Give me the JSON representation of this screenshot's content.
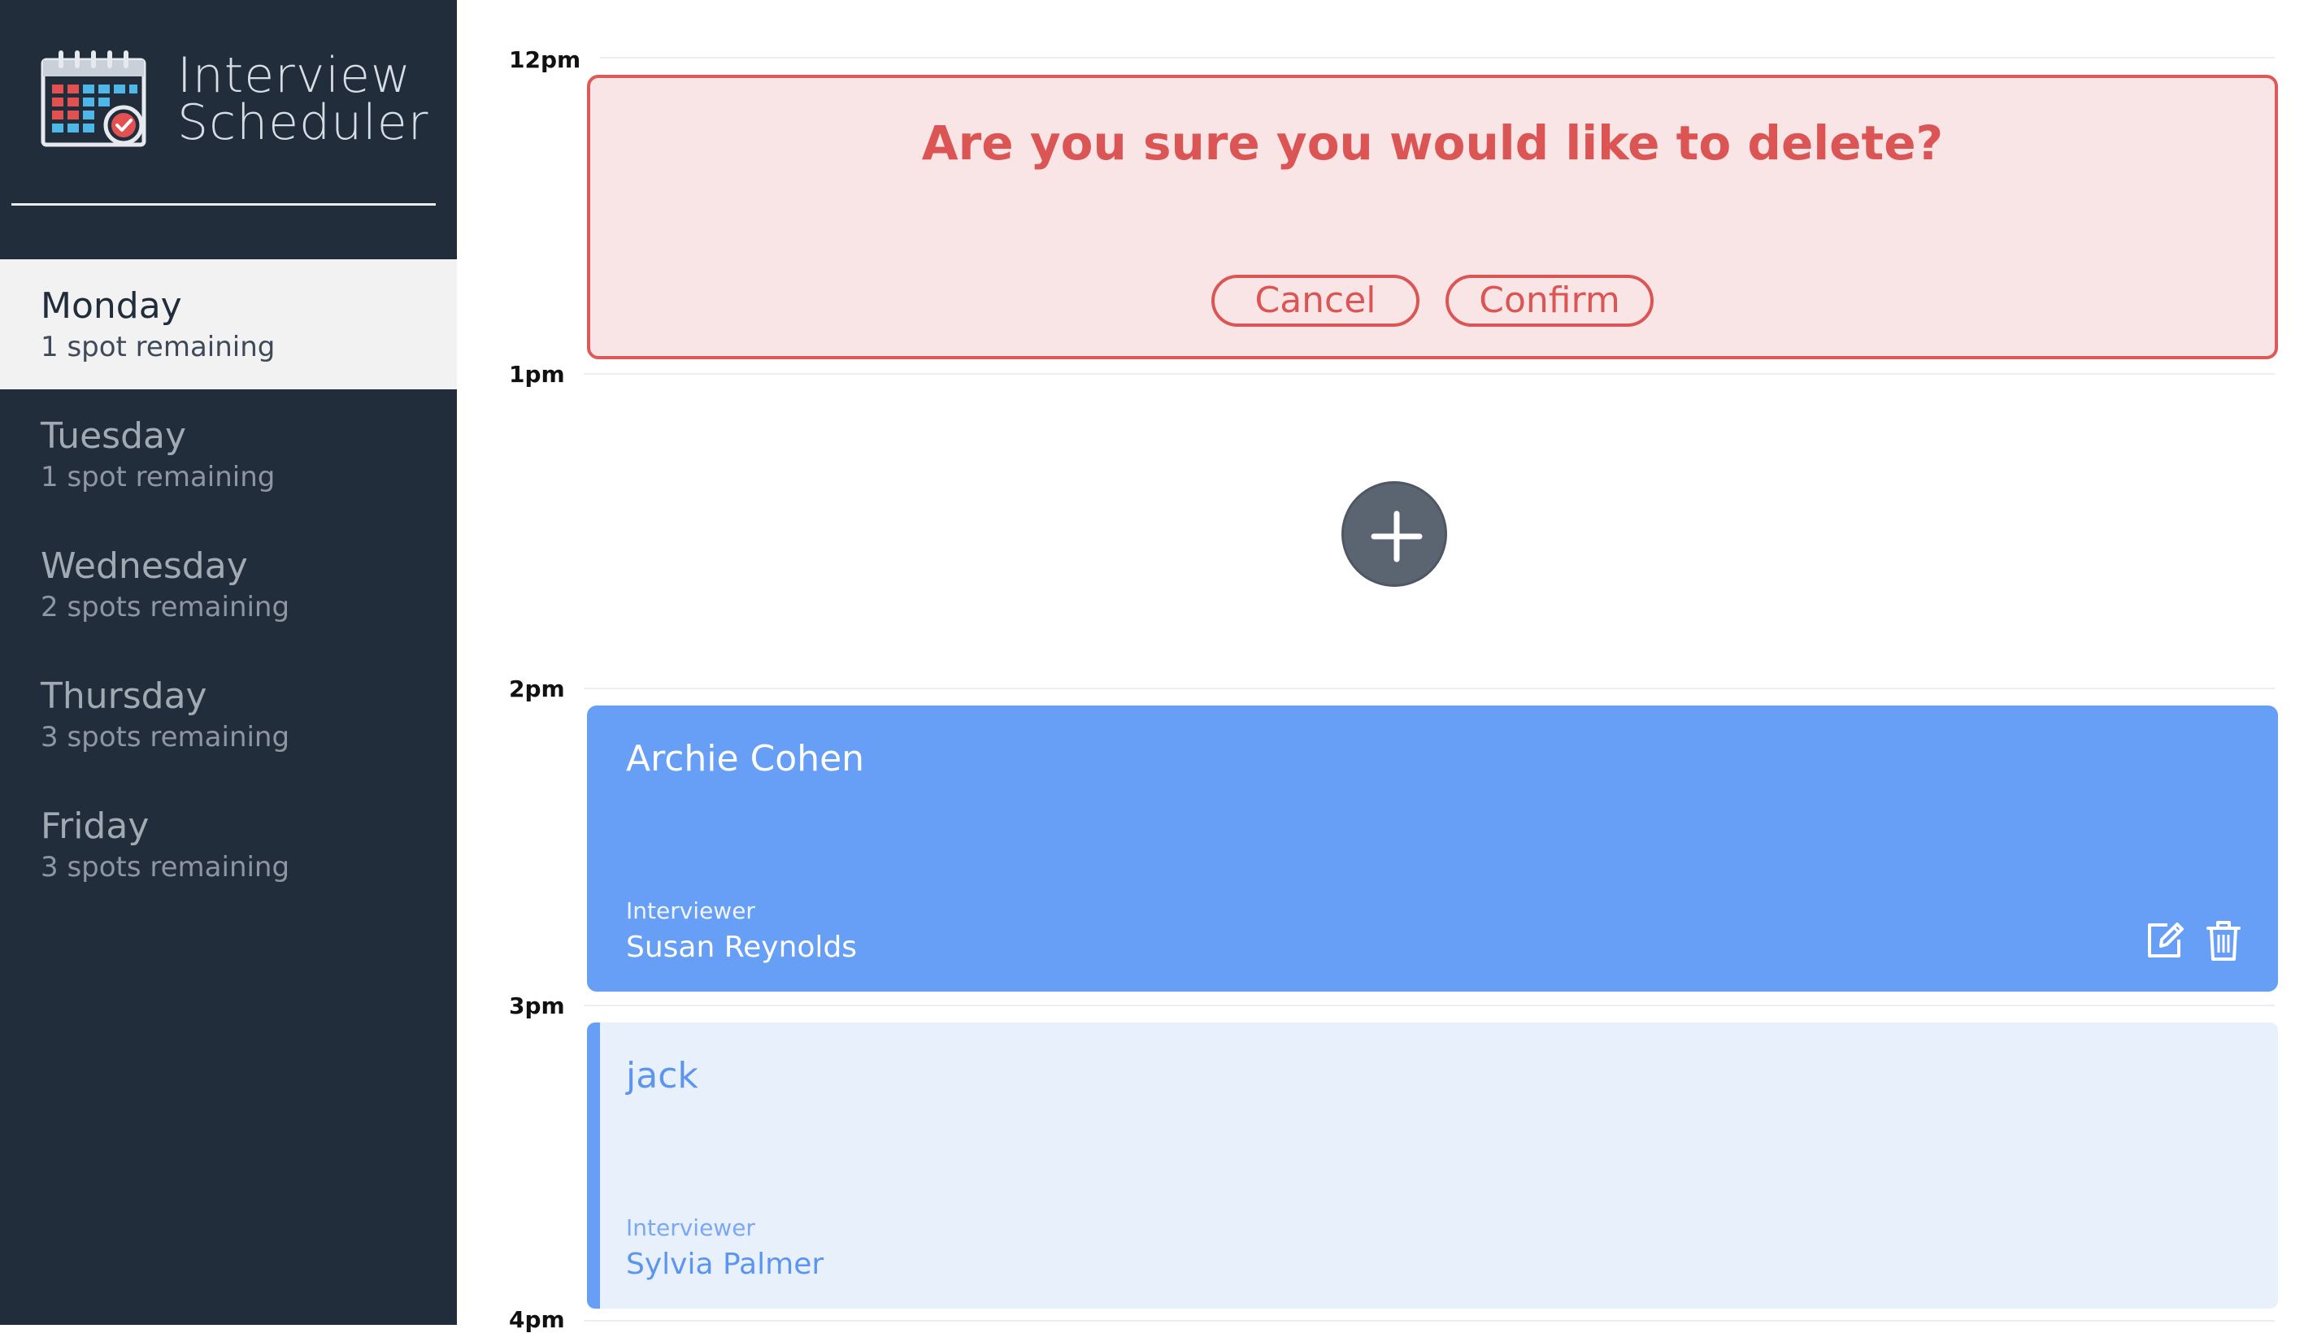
{
  "app": {
    "title_line1": "Interview",
    "title_line2": "Scheduler"
  },
  "sidebar": {
    "days": [
      {
        "name": "Monday",
        "spots": "1 spot remaining",
        "selected": true
      },
      {
        "name": "Tuesday",
        "spots": "1 spot remaining",
        "selected": false
      },
      {
        "name": "Wednesday",
        "spots": "2 spots remaining",
        "selected": false
      },
      {
        "name": "Thursday",
        "spots": "3 spots remaining",
        "selected": false
      },
      {
        "name": "Friday",
        "spots": "3 spots remaining",
        "selected": false
      }
    ]
  },
  "schedule": {
    "times": [
      "12pm",
      "1pm",
      "2pm",
      "3pm",
      "4pm"
    ],
    "confirm": {
      "message": "Are you sure you would like to delete?",
      "cancel_label": "Cancel",
      "confirm_label": "Confirm"
    },
    "appointments": [
      {
        "student": "Archie Cohen",
        "interviewer_label": "Interviewer",
        "interviewer": "Susan Reynolds"
      },
      {
        "student": "jack",
        "interviewer_label": "Interviewer",
        "interviewer": "Sylvia Palmer"
      }
    ]
  },
  "icons": {
    "logo": "calendar-check-icon",
    "add": "plus-icon",
    "edit": "edit-icon",
    "delete": "trash-icon"
  },
  "colors": {
    "sidebar_bg": "#222d3c",
    "selected_day_bg": "#f2f2f2",
    "danger": "#dc5555",
    "danger_bg": "#f9e5e5",
    "appointment_blue": "#679ff6",
    "appointment_light": "#e8f0fc",
    "add_button": "#5b6571"
  }
}
